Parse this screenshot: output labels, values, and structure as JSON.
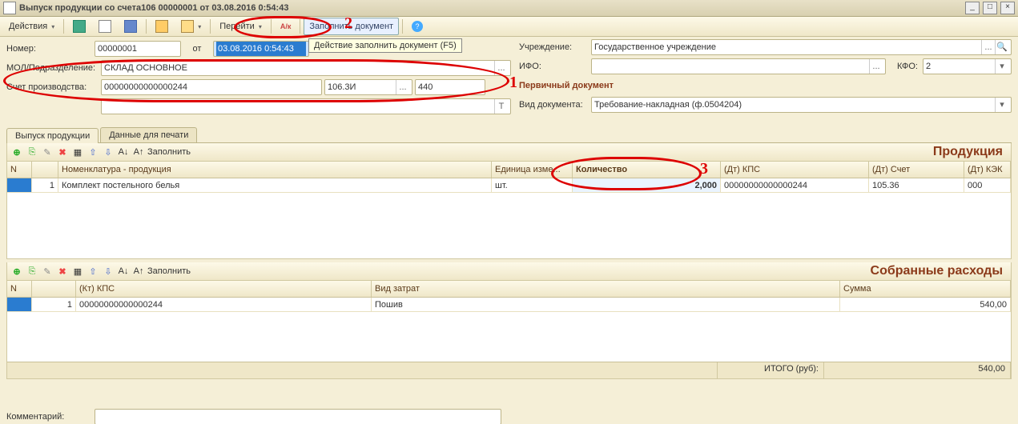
{
  "title": "Выпуск продукции со счета106 00000001 от 03.08.2016 0:54:43",
  "toolbar": {
    "actions": "Действия",
    "goto": "Перейти",
    "fill_doc": "Заполнить документ",
    "ak": "А/к"
  },
  "tooltip": "Действие заполнить документ (F5)",
  "form": {
    "number_lbl": "Номер:",
    "number_val": "00000001",
    "date_lbl": "от",
    "date_val": "03.08.2016  0:54:43",
    "mol_lbl": "МОЛ/Подразделение:",
    "mol_val": "СКЛАД ОСНОВНОЕ",
    "acct_lbl": "Счет производства:",
    "acct_val": "00000000000000244",
    "acct2_val": "106.3И",
    "acct3_val": "440"
  },
  "right": {
    "org_lbl": "Учреждение:",
    "org_val": "Государственное учреждение",
    "ifo_lbl": "ИФО:",
    "ifo_val": "",
    "kfo_lbl": "КФО:",
    "kfo_val": "2",
    "group": "Первичный документ",
    "doctype_lbl": "Вид документа:",
    "doctype_val": "Требование-накладная (ф.0504204)"
  },
  "tabs": [
    "Выпуск продукции",
    "Данные для печати"
  ],
  "subtoolbar": {
    "fill": "Заполнить"
  },
  "table1": {
    "title": "Продукция",
    "headers": [
      "N",
      "",
      "Номенклатура - продукция",
      "Единица изме...",
      "Количество",
      "(Дт) КПС",
      "(Дт) Счет",
      "(Дт) КЭК"
    ],
    "row": {
      "n": "1",
      "nom": "Комплект постельного белья",
      "unit": "шт.",
      "qty": "2,000",
      "kps": "00000000000000244",
      "acct": "105.36",
      "kek": "000"
    }
  },
  "table2": {
    "title": "Собранные расходы",
    "headers": [
      "N",
      "",
      "(Кт) КПС",
      "Вид затрат",
      "Сумма"
    ],
    "row": {
      "n": "1",
      "kps": "00000000000000244",
      "type": "Пошив",
      "sum": "540,00"
    },
    "total_lbl": "ИТОГО (руб):",
    "total_val": "540,00"
  },
  "comment_lbl": "Комментарий:",
  "annotations": {
    "n1": "1",
    "n2": "2",
    "n3": "3"
  }
}
